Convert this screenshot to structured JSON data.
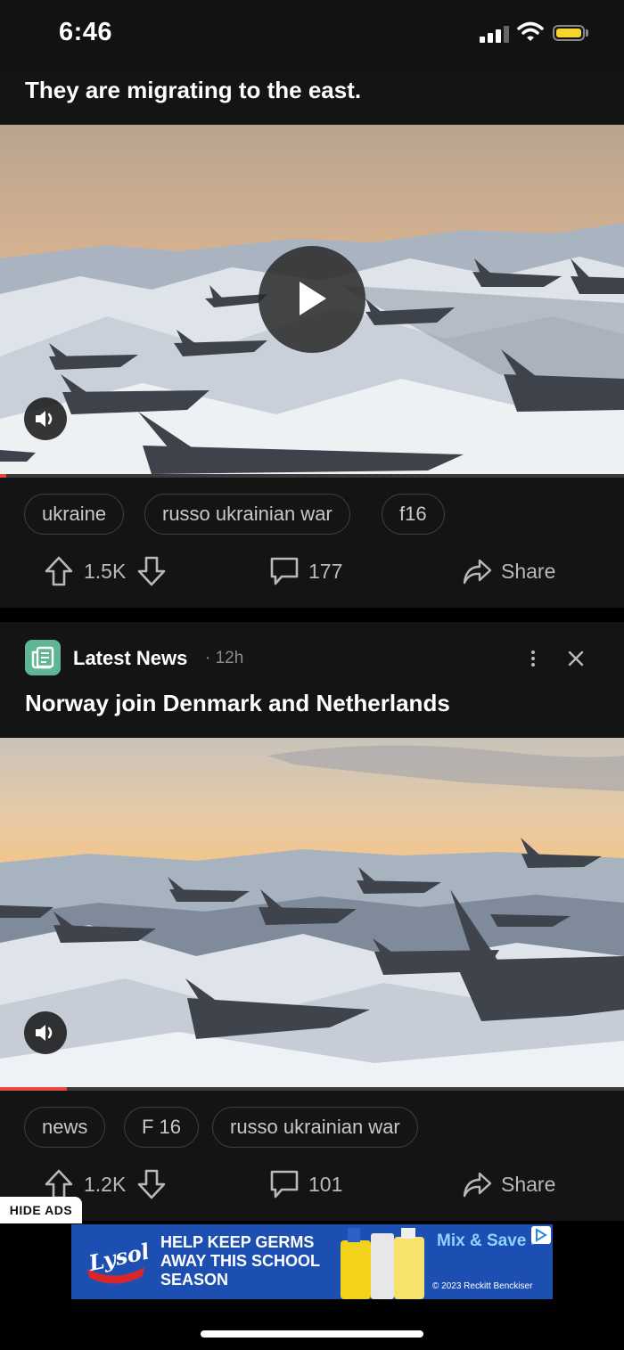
{
  "status_bar": {
    "time": "6:46"
  },
  "post1": {
    "title": "They are migrating to the east.",
    "video_progress": 0.01,
    "tags": [
      "ukraine",
      "russo ukrainian war",
      "f16"
    ],
    "upvotes": "1.5K",
    "comments": "177",
    "share_label": "Share"
  },
  "post2": {
    "subreddit": "Latest News",
    "time": "· 12h",
    "title": "Norway join Denmark and Netherlands",
    "video_progress": 0.107,
    "tags": [
      "news",
      "F 16",
      "russo ukrainian war"
    ],
    "upvotes": "1.2K",
    "comments": "101",
    "share_label": "Share"
  },
  "ads": {
    "hide_label": "HIDE ADS",
    "brand": "Lysol",
    "headline": "HELP KEEP GERMS AWAY THIS SCHOOL SEASON",
    "cta": "Mix & Save >",
    "copyright": "© 2023 Reckitt Benckiser"
  },
  "icons": {
    "upvote": "arrow-up-icon",
    "downvote": "arrow-down-icon",
    "comment": "comment-bubble-icon",
    "share": "share-arrow-icon",
    "play": "play-icon",
    "mute": "speaker-icon"
  },
  "colors": {
    "background": "#111111",
    "progress": "#e8453c",
    "subreddit_icon": "#5fb594",
    "ad_blue": "#1d4fb3"
  }
}
